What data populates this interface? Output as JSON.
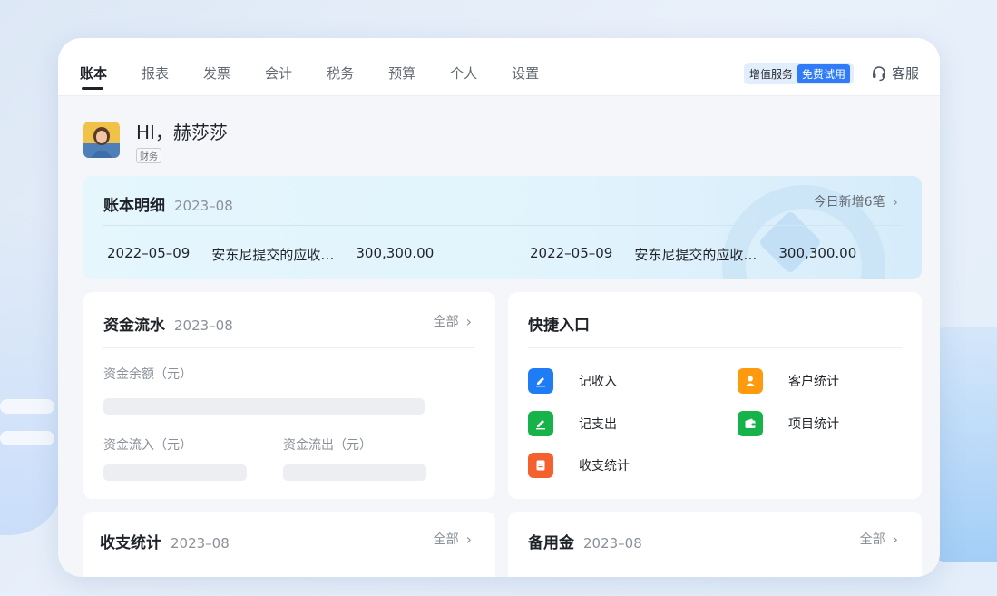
{
  "nav": {
    "tabs": [
      "账本",
      "报表",
      "发票",
      "会计",
      "税务",
      "预算",
      "个人",
      "设置"
    ],
    "active_tab": "账本",
    "value_service_label": "增值服务",
    "trial_label": "免费试用",
    "customer_service_label": "客服"
  },
  "user": {
    "greeting": "HI，赫莎莎",
    "role": "财务"
  },
  "ledger": {
    "title": "账本明细",
    "date": "2023–08",
    "more_label": "今日新增6笔",
    "rows": [
      {
        "date": "2022–05–09",
        "desc": "安东尼提交的应收…",
        "amount": "300,300.00"
      },
      {
        "date": "2022–05–09",
        "desc": "安东尼提交的应收…",
        "amount": "300,300.00"
      }
    ]
  },
  "cashflow": {
    "title": "资金流水",
    "date": "2023–08",
    "more_label": "全部",
    "balance_label": "资金余额（元）",
    "inflow_label": "资金流入（元）",
    "outflow_label": "资金流出（元）"
  },
  "shortcuts": {
    "title": "快捷入口",
    "items": [
      {
        "label": "记收入",
        "icon": "pencil-icon",
        "color": "#1e7cf5"
      },
      {
        "label": "客户统计",
        "icon": "user-icon",
        "color": "#ff9a0e"
      },
      {
        "label": "记支出",
        "icon": "pencil-icon",
        "color": "#15b34a"
      },
      {
        "label": "项目统计",
        "icon": "wallet-icon",
        "color": "#15b34a"
      },
      {
        "label": "收支统计",
        "icon": "document-icon",
        "color": "#f5602f"
      }
    ]
  },
  "income_stats": {
    "title": "收支统计",
    "date": "2023–08",
    "more_label": "全部"
  },
  "petty_cash": {
    "title": "备用金",
    "date": "2023–08",
    "more_label": "全部"
  },
  "colors": {
    "accent": "#2f7cf6",
    "ledger_bg": "#e3f4fc"
  }
}
